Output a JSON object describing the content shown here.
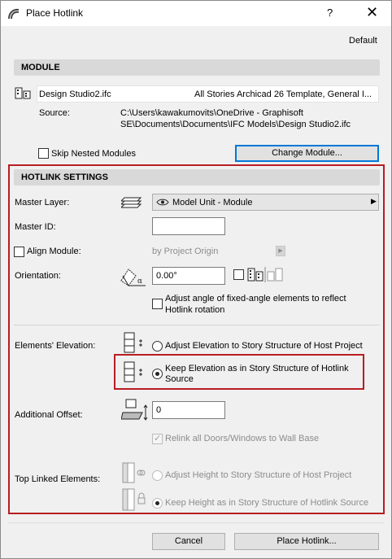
{
  "window": {
    "title": "Place Hotlink",
    "help_label": "?",
    "close_label": "✕"
  },
  "header": {
    "default_label": "Default"
  },
  "module": {
    "section_title": "MODULE",
    "file_name": "Design Studio2.ifc",
    "template": "All Stories Archicad 26 Template, General I...",
    "source_label": "Source:",
    "source_line1": "C:\\Users\\kawakumovits\\OneDrive - Graphisoft",
    "source_line2": "SE\\Documents\\Documents\\IFC Models\\Design Studio2.ifc",
    "skip_nested_label": "Skip Nested Modules",
    "change_module_label": "Change Module..."
  },
  "hotlink": {
    "section_title": "HOTLINK SETTINGS",
    "master_layer_label": "Master Layer:",
    "master_layer_value": "Model Unit - Module",
    "master_id_label": "Master ID:",
    "master_id_value": "",
    "align_module_label": "Align Module:",
    "align_module_value": "by Project Origin",
    "orientation_label": "Orientation:",
    "orientation_value": "0.00°",
    "adjust_angle_label_line1": "Adjust angle of fixed-angle elements to reflect",
    "adjust_angle_label_line2": "Hotlink rotation",
    "elements_elevation_label": "Elements' Elevation:",
    "elev_option1": "Adjust Elevation to Story Structure of Host Project",
    "elev_option2_line1": "Keep Elevation as in Story Structure of Hotlink",
    "elev_option2_line2": "Source",
    "additional_offset_label": "Additional Offset:",
    "additional_offset_value": "0",
    "relink_label": "Relink all Doors/Windows to Wall Base",
    "top_linked_label": "Top Linked Elements:",
    "top_option1": "Adjust Height to Story Structure of Host Project",
    "top_option2": "Keep Height as in Story Structure of Hotlink Source"
  },
  "footer": {
    "cancel_label": "Cancel",
    "place_label": "Place Hotlink..."
  },
  "colors": {
    "highlight_frame": "#b81d22",
    "focus_border": "#0078d7"
  }
}
